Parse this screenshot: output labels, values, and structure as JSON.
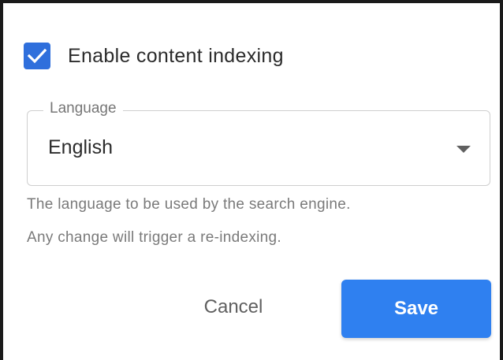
{
  "indexing": {
    "label": "Enable content indexing",
    "checked": true
  },
  "language": {
    "legend": "Language",
    "selected": "English",
    "helper_lines": [
      "The language to be used by the search engine.",
      "Any change will trigger a re-indexing."
    ]
  },
  "actions": {
    "cancel_label": "Cancel",
    "save_label": "Save"
  },
  "colors": {
    "accent": "#2f80f0",
    "checkbox": "#2f6fdc"
  }
}
